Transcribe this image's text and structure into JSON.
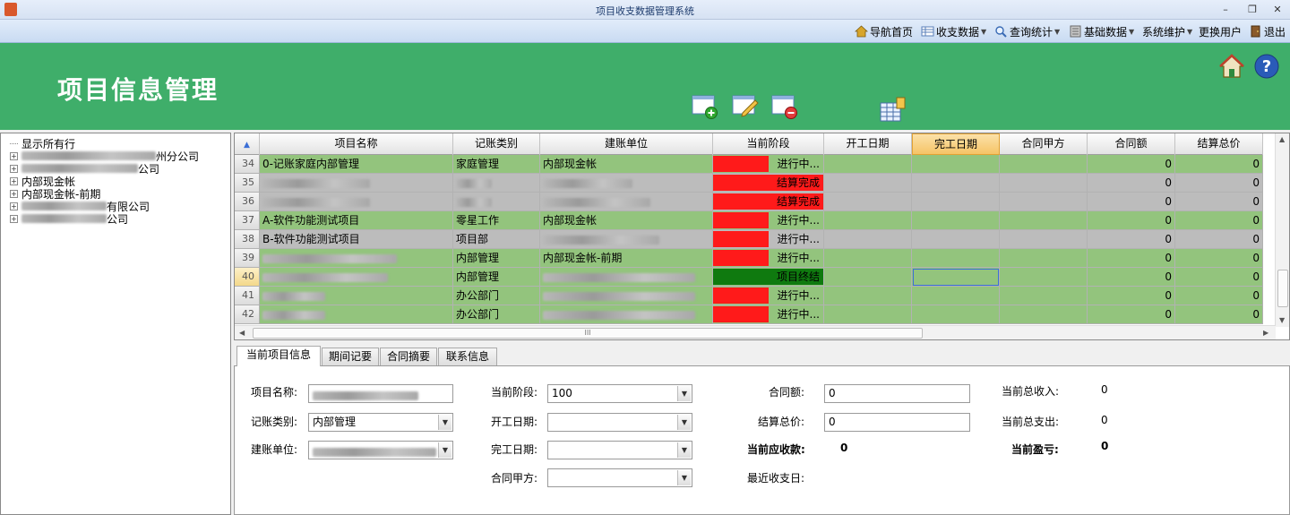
{
  "window": {
    "title": "项目收支数据管理系统"
  },
  "menu": [
    {
      "label": "导航首页",
      "icon": "home-icon",
      "dropdown": false
    },
    {
      "label": "收支数据",
      "icon": "table-icon",
      "dropdown": true
    },
    {
      "label": "查询统计",
      "icon": "search-icon",
      "dropdown": true
    },
    {
      "label": "基础数据",
      "icon": "database-icon",
      "dropdown": true
    },
    {
      "label": "系统维护",
      "icon": "",
      "dropdown": true
    },
    {
      "label": "更换用户",
      "icon": "",
      "dropdown": false
    },
    {
      "label": "退出",
      "icon": "exit-door-icon",
      "dropdown": false
    }
  ],
  "banner": {
    "heading": "项目信息管理"
  },
  "tree": {
    "items": [
      {
        "label": "显示所有行",
        "expandable": false,
        "prefix_blur": 0
      },
      {
        "label": "州分公司",
        "expandable": true,
        "prefix_blur": 150
      },
      {
        "label": "公司",
        "expandable": true,
        "prefix_blur": 130
      },
      {
        "label": "内部现金帐",
        "expandable": true,
        "prefix_blur": 0
      },
      {
        "label": "内部现金帐-前期",
        "expandable": true,
        "prefix_blur": 0
      },
      {
        "label": "有限公司",
        "expandable": true,
        "prefix_blur": 95
      },
      {
        "label": "公司",
        "expandable": true,
        "prefix_blur": 95
      }
    ]
  },
  "grid": {
    "columns": [
      "项目名称",
      "记账类别",
      "建账单位",
      "当前阶段",
      "开工日期",
      "完工日期",
      "合同甲方",
      "合同额",
      "结算总价"
    ],
    "sorted_column": "完工日期",
    "rows": [
      {
        "no": "34",
        "name": "0-记账家庭内部管理",
        "category": "家庭管理",
        "unit": "内部现金帐",
        "stage": "进行中...",
        "stage_color": "#ff1a1a",
        "stage_fill": 0.5,
        "amount": "0",
        "settle": "0",
        "row_color": "#93c47d",
        "blur": [
          0,
          0,
          0
        ]
      },
      {
        "no": "35",
        "name": "",
        "category": "",
        "unit": "",
        "stage": "结算完成",
        "stage_color": "#ff1a1a",
        "stage_fill": 1.0,
        "amount": "0",
        "settle": "0",
        "row_color": "#bcbcbc",
        "blur": [
          120,
          40,
          100
        ]
      },
      {
        "no": "36",
        "name": "",
        "category": "",
        "unit": "",
        "stage": "结算完成",
        "stage_color": "#ff1a1a",
        "stage_fill": 1.0,
        "amount": "0",
        "settle": "0",
        "row_color": "#bcbcbc",
        "blur": [
          120,
          40,
          120
        ]
      },
      {
        "no": "37",
        "name": "A-软件功能测试项目",
        "category": "零星工作",
        "unit": "内部现金帐",
        "stage": "进行中...",
        "stage_color": "#ff1a1a",
        "stage_fill": 0.5,
        "amount": "0",
        "settle": "0",
        "row_color": "#93c47d",
        "blur": [
          0,
          0,
          0
        ]
      },
      {
        "no": "38",
        "name": "B-软件功能测试项目",
        "category": "项目部",
        "unit": "",
        "stage": "进行中...",
        "stage_color": "#ff1a1a",
        "stage_fill": 0.5,
        "amount": "0",
        "settle": "0",
        "row_color": "#bcbcbc",
        "blur": [
          0,
          0,
          130
        ]
      },
      {
        "no": "39",
        "name": "",
        "category": "内部管理",
        "unit": "内部现金帐-前期",
        "stage": "进行中...",
        "stage_color": "#ff1a1a",
        "stage_fill": 0.5,
        "amount": "0",
        "settle": "0",
        "row_color": "#93c47d",
        "blur": [
          150,
          0,
          0
        ]
      },
      {
        "no": "40",
        "name": "",
        "category": "内部管理",
        "unit": "",
        "stage": "项目终结",
        "stage_color": "#0f7a0f",
        "stage_fill": 1.0,
        "amount": "0",
        "settle": "0",
        "row_color": "#93c47d",
        "blur": [
          140,
          0,
          170
        ]
      },
      {
        "no": "41",
        "name": "",
        "category": "办公部门",
        "unit": "",
        "stage": "进行中...",
        "stage_color": "#ff1a1a",
        "stage_fill": 0.5,
        "amount": "0",
        "settle": "0",
        "row_color": "#93c47d",
        "blur": [
          70,
          0,
          170
        ]
      },
      {
        "no": "42",
        "name": "",
        "category": "办公部门",
        "unit": "",
        "stage": "进行中...",
        "stage_color": "#ff1a1a",
        "stage_fill": 0.5,
        "amount": "0",
        "settle": "0",
        "row_color": "#93c47d",
        "blur": [
          70,
          0,
          170
        ]
      }
    ]
  },
  "tabs": [
    "当前项目信息",
    "期间记要",
    "合同摘要",
    "联系信息"
  ],
  "form": {
    "project_name_label": "项目名称:",
    "category_label": "记账类别:",
    "category_value": "内部管理",
    "unit_label": "建账单位:",
    "stage_label": "当前阶段:",
    "stage_value": "100",
    "start_label": "开工日期:",
    "end_label": "完工日期:",
    "party_label": "合同甲方:",
    "amount_label": "合同额:",
    "amount_value": "0",
    "settle_label": "结算总价:",
    "settle_value": "0",
    "receivable_label": "当前应收款:",
    "receivable_value": "0",
    "last_date_label": "最近收支日:",
    "income_label": "当前总收入:",
    "income_value": "0",
    "expense_label": "当前总支出:",
    "expense_value": "0",
    "profit_label": "当前盈亏:",
    "profit_value": "0"
  }
}
